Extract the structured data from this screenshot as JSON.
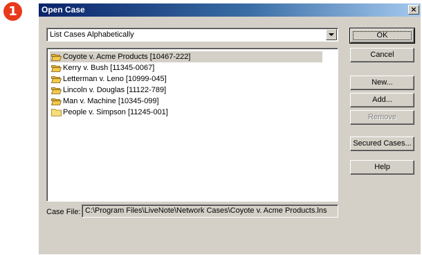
{
  "step_badge": "1",
  "window": {
    "title": "Open Case",
    "close_glyph": "×"
  },
  "sort_select": {
    "value": "List Cases Alphabetically"
  },
  "cases": [
    {
      "label": "Coyote v. Acme Products  [10467-222]",
      "icon": "open-folder-icon",
      "selected": true
    },
    {
      "label": "Kerry v. Bush  [11345-0067]",
      "icon": "open-folder-icon",
      "selected": false
    },
    {
      "label": "Letterman v. Leno  [10999-045]",
      "icon": "open-folder-icon",
      "selected": false
    },
    {
      "label": "Lincoln v. Douglas  [11122-789]",
      "icon": "open-folder-icon",
      "selected": false
    },
    {
      "label": "Man v. Machine  [10345-099]",
      "icon": "open-folder-icon",
      "selected": false
    },
    {
      "label": "People v. Simpson  [11245-001]",
      "icon": "closed-folder-icon",
      "selected": false
    }
  ],
  "buttons": {
    "ok": "OK",
    "cancel": "Cancel",
    "new": "New...",
    "add": "Add...",
    "remove": "Remove",
    "secured_cases": "Secured Cases...",
    "help": "Help"
  },
  "case_file": {
    "label": "Case File:",
    "value": "C:\\Program Files\\LiveNote\\Network Cases\\Coyote v. Acme Products.lns"
  },
  "colors": {
    "dialog_face": "#d4d0c8",
    "title_gradient_start": "#0a246a",
    "title_gradient_end": "#a6caf0",
    "badge": "#e8391b",
    "folder": "#f2c94c"
  }
}
